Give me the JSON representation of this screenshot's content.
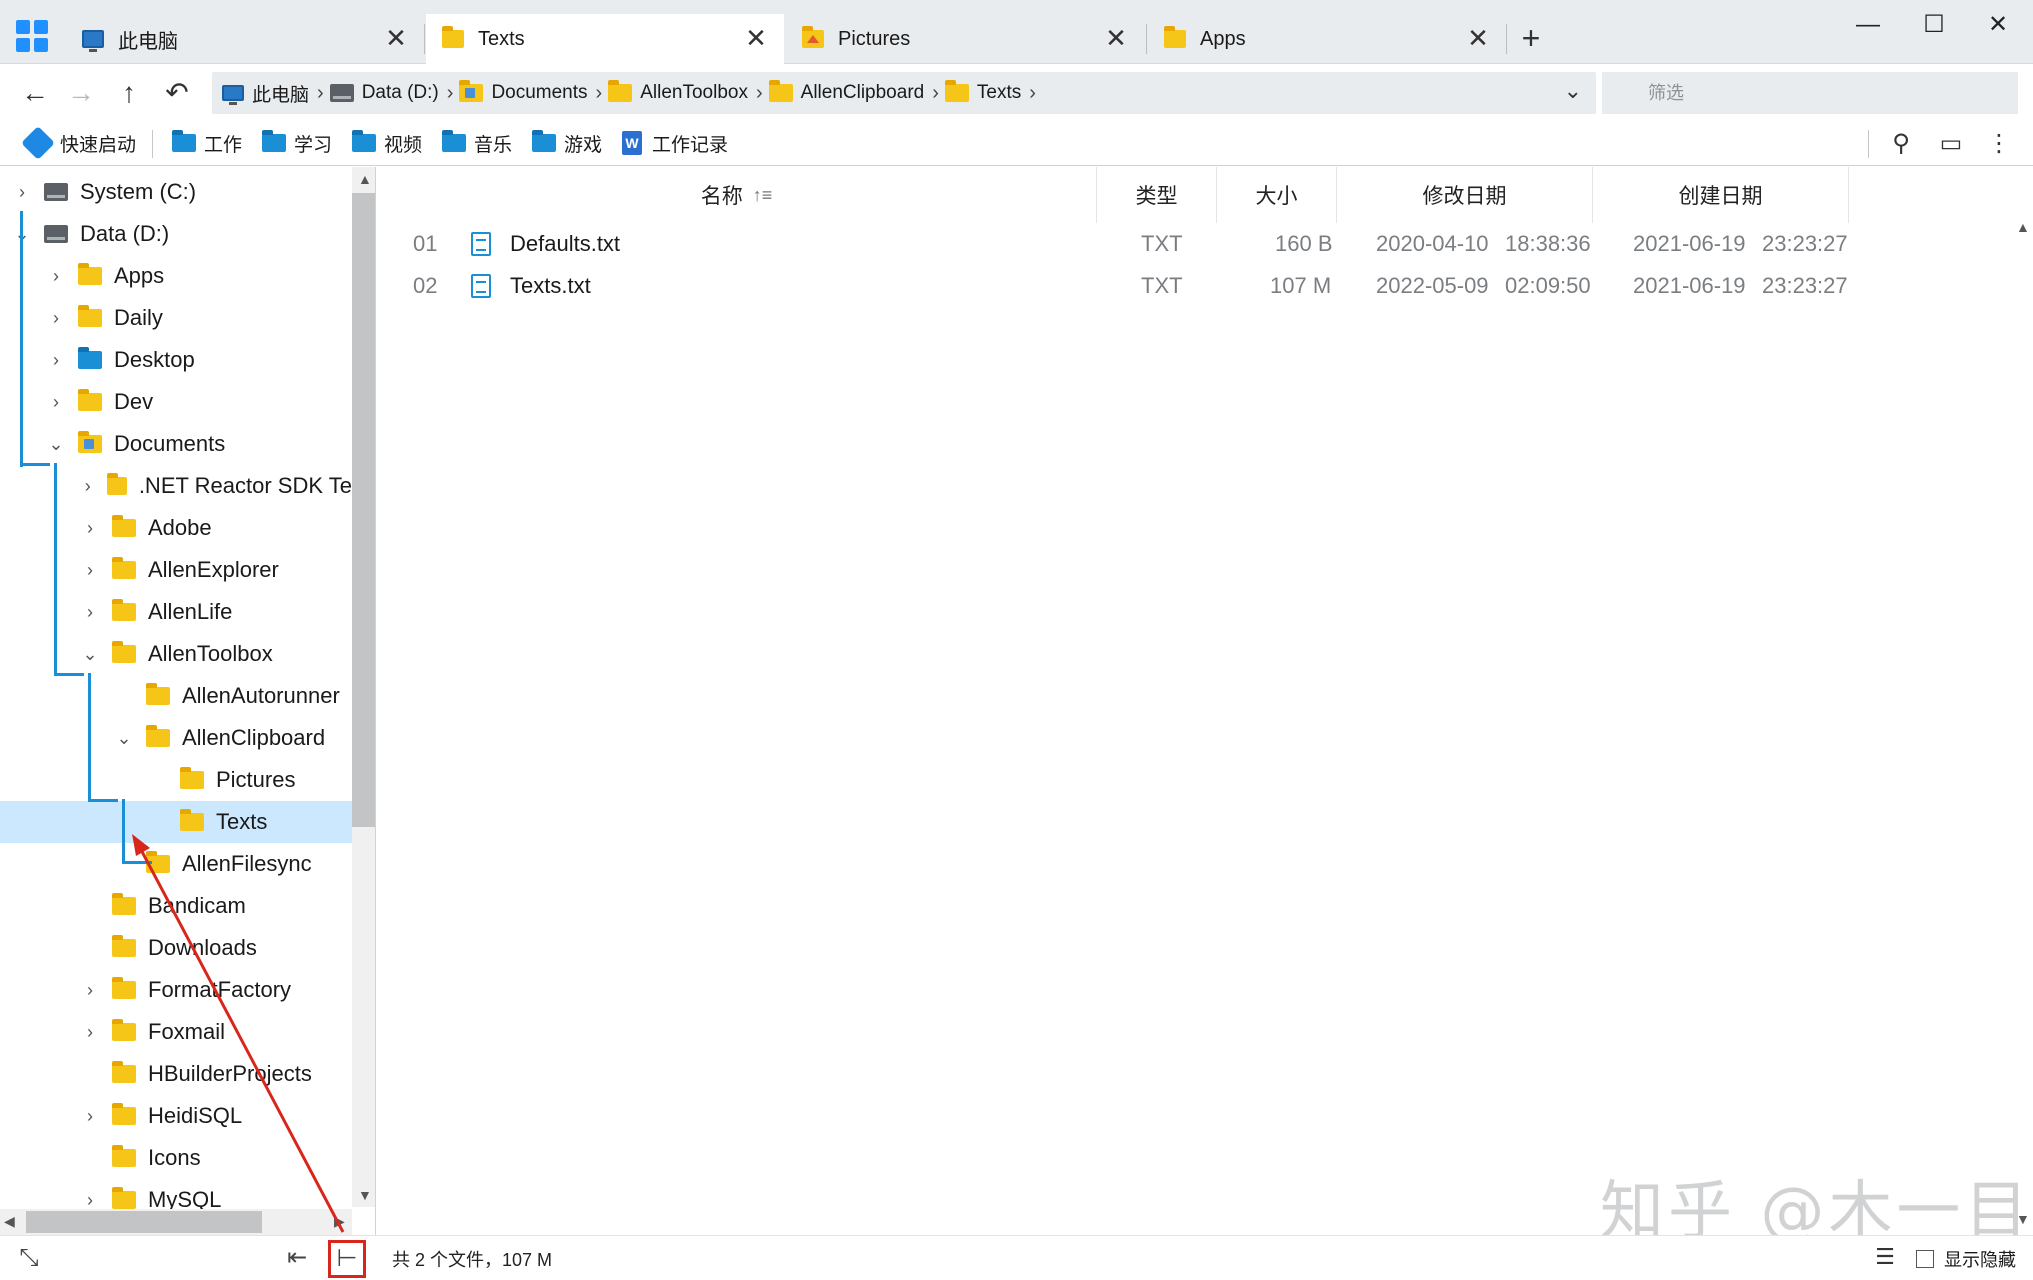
{
  "tabs": [
    {
      "label": "此电脑",
      "icon": "computer-icon"
    },
    {
      "label": "Texts",
      "icon": "folder-icon",
      "active": true
    },
    {
      "label": "Pictures",
      "icon": "pictures-folder-icon"
    },
    {
      "label": "Apps",
      "icon": "folder-icon"
    }
  ],
  "window_controls": {
    "new_tab": "+",
    "minimize": "—",
    "maximize": "☐",
    "close": "✕"
  },
  "breadcrumbs": [
    "此电脑",
    "Data (D:)",
    "Documents",
    "AllenToolbox",
    "AllenClipboard",
    "Texts"
  ],
  "filter": {
    "placeholder": "筛选"
  },
  "bookmarks": [
    "快速启动",
    "工作",
    "学习",
    "视频",
    "音乐",
    "游戏",
    "工作记录"
  ],
  "tree": [
    {
      "label": "System (C:)",
      "icon": "drive-icon",
      "chevron": "›"
    },
    {
      "label": "Data (D:)",
      "icon": "drive-icon",
      "chevron": "⌄"
    },
    {
      "label": "Apps",
      "icon": "folder-icon",
      "chevron": "›"
    },
    {
      "label": "Daily",
      "icon": "folder-icon",
      "chevron": "›"
    },
    {
      "label": "Desktop",
      "icon": "desktop-folder-icon",
      "chevron": "›"
    },
    {
      "label": "Dev",
      "icon": "folder-icon",
      "chevron": "›"
    },
    {
      "label": "Documents",
      "icon": "documents-folder-icon",
      "chevron": "⌄"
    },
    {
      "label": ".NET Reactor SDK Te",
      "icon": "folder-icon",
      "chevron": "›"
    },
    {
      "label": "Adobe",
      "icon": "folder-icon",
      "chevron": "›"
    },
    {
      "label": "AllenExplorer",
      "icon": "folder-icon",
      "chevron": "›"
    },
    {
      "label": "AllenLife",
      "icon": "folder-icon",
      "chevron": "›"
    },
    {
      "label": "AllenToolbox",
      "icon": "folder-icon",
      "chevron": "⌄"
    },
    {
      "label": "AllenAutorunner",
      "icon": "folder-icon",
      "chevron": ""
    },
    {
      "label": "AllenClipboard",
      "icon": "folder-icon",
      "chevron": "⌄"
    },
    {
      "label": "Pictures",
      "icon": "folder-icon",
      "chevron": ""
    },
    {
      "label": "Texts",
      "icon": "folder-icon",
      "chevron": "",
      "selected": true
    },
    {
      "label": "AllenFilesync",
      "icon": "folder-icon",
      "chevron": ""
    },
    {
      "label": "Bandicam",
      "icon": "folder-icon",
      "chevron": ""
    },
    {
      "label": "Downloads",
      "icon": "folder-icon",
      "chevron": ""
    },
    {
      "label": "FormatFactory",
      "icon": "folder-icon",
      "chevron": "›"
    },
    {
      "label": "Foxmail",
      "icon": "folder-icon",
      "chevron": "›"
    },
    {
      "label": "HBuilderProjects",
      "icon": "folder-icon",
      "chevron": ""
    },
    {
      "label": "HeidiSQL",
      "icon": "folder-icon",
      "chevron": "›"
    },
    {
      "label": "Icons",
      "icon": "folder-icon",
      "chevron": ""
    },
    {
      "label": "MySQL",
      "icon": "folder-icon",
      "chevron": "›"
    }
  ],
  "columns": {
    "name": "名称",
    "type": "类型",
    "size": "大小",
    "modified": "修改日期",
    "created": "创建日期"
  },
  "files": [
    {
      "num": "01",
      "name": "Defaults.txt",
      "type": "TXT",
      "size": "160 B",
      "modified_date": "2020-04-10",
      "modified_time": "18:38:36",
      "created_date": "2021-06-19",
      "created_time": "23:23:27"
    },
    {
      "num": "02",
      "name": "Texts.txt",
      "type": "TXT",
      "size": "107 M",
      "modified_date": "2022-05-09",
      "modified_time": "02:09:50",
      "created_date": "2021-06-19",
      "created_time": "23:23:27"
    }
  ],
  "status": {
    "summary": "共 2 个文件，107 M",
    "show_hidden": "显示隐藏"
  },
  "watermark": "知乎 @木一目",
  "colors": {
    "accent": "#1b8fd6",
    "selection": "#cce8ff",
    "annotation": "#d9261c",
    "folder": "#f5c518"
  }
}
